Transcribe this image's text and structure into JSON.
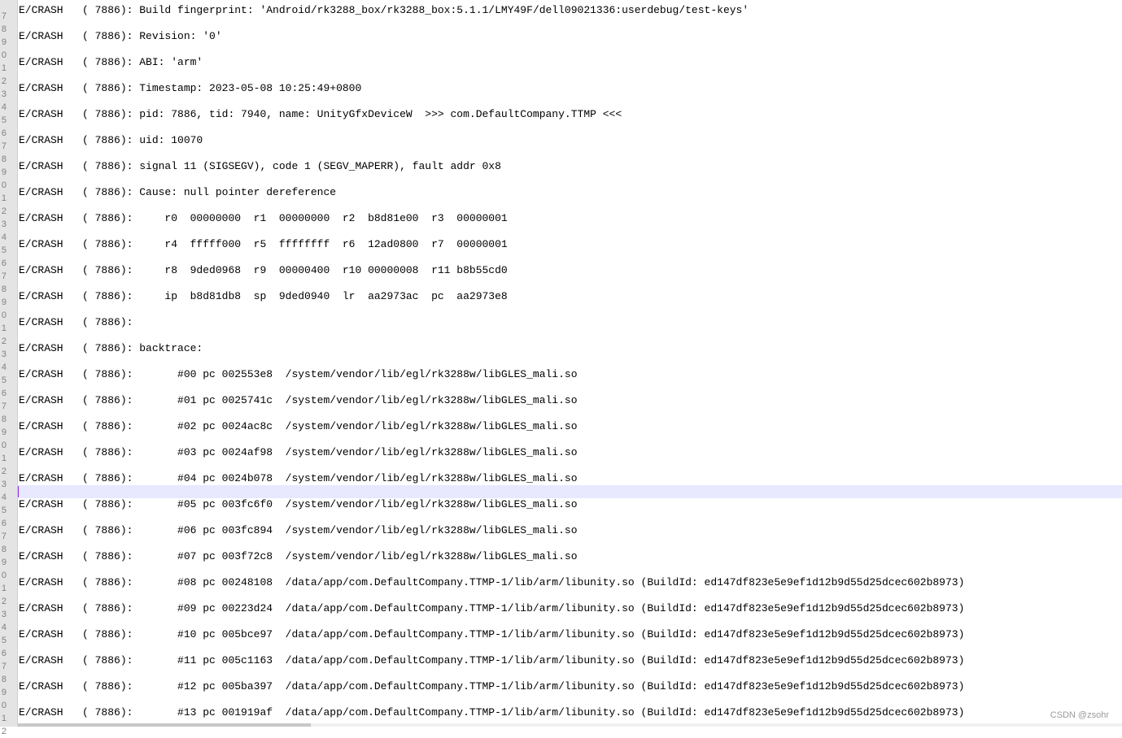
{
  "gutter_numbers": [
    "7",
    "8",
    "9",
    "0",
    "1",
    "2",
    "3",
    "4",
    "5",
    "6",
    "7",
    "8",
    "9",
    "0",
    "1",
    "2",
    "3",
    "4",
    "5",
    "6",
    "7",
    "8",
    "9",
    "0",
    "1",
    "2",
    "3",
    "4",
    "5",
    "6",
    "7",
    "8",
    "9",
    "0",
    "1",
    "2",
    "3",
    "4",
    "5",
    "6",
    "7",
    "8",
    "9",
    "0",
    "1",
    "2",
    "3",
    "4",
    "5",
    "6",
    "7",
    "8",
    "9",
    "0",
    "1",
    "2"
  ],
  "log_lines": [
    "E/CRASH   ( 7886): Build fingerprint: 'Android/rk3288_box/rk3288_box:5.1.1/LMY49F/dell09021336:userdebug/test-keys'",
    "",
    "E/CRASH   ( 7886): Revision: '0'",
    "",
    "E/CRASH   ( 7886): ABI: 'arm'",
    "",
    "E/CRASH   ( 7886): Timestamp: 2023-05-08 10:25:49+0800",
    "",
    "E/CRASH   ( 7886): pid: 7886, tid: 7940, name: UnityGfxDeviceW  >>> com.DefaultCompany.TTMP <<<",
    "",
    "E/CRASH   ( 7886): uid: 10070",
    "",
    "E/CRASH   ( 7886): signal 11 (SIGSEGV), code 1 (SEGV_MAPERR), fault addr 0x8",
    "",
    "E/CRASH   ( 7886): Cause: null pointer dereference",
    "",
    "E/CRASH   ( 7886):     r0  00000000  r1  00000000  r2  b8d81e00  r3  00000001",
    "",
    "E/CRASH   ( 7886):     r4  fffff000  r5  ffffffff  r6  12ad0800  r7  00000001",
    "",
    "E/CRASH   ( 7886):     r8  9ded0968  r9  00000400  r10 00000008  r11 b8b55cd0",
    "",
    "E/CRASH   ( 7886):     ip  b8d81db8  sp  9ded0940  lr  aa2973ac  pc  aa2973e8",
    "",
    "E/CRASH   ( 7886):",
    "",
    "E/CRASH   ( 7886): backtrace:",
    "",
    "E/CRASH   ( 7886):       #00 pc 002553e8  /system/vendor/lib/egl/rk3288w/libGLES_mali.so",
    "",
    "E/CRASH   ( 7886):       #01 pc 0025741c  /system/vendor/lib/egl/rk3288w/libGLES_mali.so",
    "",
    "E/CRASH   ( 7886):       #02 pc 0024ac8c  /system/vendor/lib/egl/rk3288w/libGLES_mali.so",
    "",
    "E/CRASH   ( 7886):       #03 pc 0024af98  /system/vendor/lib/egl/rk3288w/libGLES_mali.so",
    "",
    "E/CRASH   ( 7886):       #04 pc 0024b078  /system/vendor/lib/egl/rk3288w/libGLES_mali.so",
    "",
    "E/CRASH   ( 7886):       #05 pc 003fc6f0  /system/vendor/lib/egl/rk3288w/libGLES_mali.so",
    "",
    "E/CRASH   ( 7886):       #06 pc 003fc894  /system/vendor/lib/egl/rk3288w/libGLES_mali.so",
    "",
    "E/CRASH   ( 7886):       #07 pc 003f72c8  /system/vendor/lib/egl/rk3288w/libGLES_mali.so",
    "",
    "E/CRASH   ( 7886):       #08 pc 00248108  /data/app/com.DefaultCompany.TTMP-1/lib/arm/libunity.so (BuildId: ed147df823e5e9ef1d12b9d55d25dcec602b8973)",
    "",
    "E/CRASH   ( 7886):       #09 pc 00223d24  /data/app/com.DefaultCompany.TTMP-1/lib/arm/libunity.so (BuildId: ed147df823e5e9ef1d12b9d55d25dcec602b8973)",
    "",
    "E/CRASH   ( 7886):       #10 pc 005bce97  /data/app/com.DefaultCompany.TTMP-1/lib/arm/libunity.so (BuildId: ed147df823e5e9ef1d12b9d55d25dcec602b8973)",
    "",
    "E/CRASH   ( 7886):       #11 pc 005c1163  /data/app/com.DefaultCompany.TTMP-1/lib/arm/libunity.so (BuildId: ed147df823e5e9ef1d12b9d55d25dcec602b8973)",
    "",
    "E/CRASH   ( 7886):       #12 pc 005ba397  /data/app/com.DefaultCompany.TTMP-1/lib/arm/libunity.so (BuildId: ed147df823e5e9ef1d12b9d55d25dcec602b8973)",
    "",
    "E/CRASH   ( 7886):       #13 pc 001919af  /data/app/com.DefaultCompany.TTMP-1/lib/arm/libunity.so (BuildId: ed147df823e5e9ef1d12b9d55d25dcec602b8973)"
  ],
  "current_line_index": 37,
  "watermark": "CSDN @zsohr",
  "colors": {
    "current_line": "#e8e8ff",
    "caret": "#8a2be2",
    "gutter": "#e4e4e4"
  }
}
